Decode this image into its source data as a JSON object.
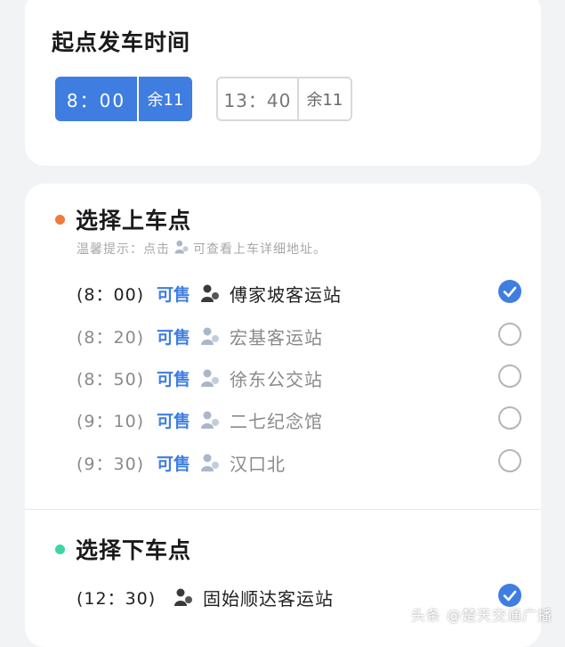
{
  "departure": {
    "title": "起点发车时间",
    "options": [
      {
        "time": "8：00",
        "remaining": "余11",
        "selected": true
      },
      {
        "time": "13：40",
        "remaining": "余11",
        "selected": false
      }
    ]
  },
  "boarding": {
    "title": "选择上车点",
    "dot_color": "#f07a3a",
    "tip_prefix": "温馨提示：点击",
    "tip_suffix": "可查看上车详细地址。",
    "stops": [
      {
        "time": "(8：00)",
        "sale": "可售",
        "name": "傅家坡客运站",
        "selected": true
      },
      {
        "time": "(8：20)",
        "sale": "可售",
        "name": "宏基客运站",
        "selected": false
      },
      {
        "time": "(8：50)",
        "sale": "可售",
        "name": "徐东公交站",
        "selected": false
      },
      {
        "time": "(9：10)",
        "sale": "可售",
        "name": "二七纪念馆",
        "selected": false
      },
      {
        "time": "(9：30)",
        "sale": "可售",
        "name": "汉口北",
        "selected": false
      }
    ]
  },
  "alighting": {
    "title": "选择下车点",
    "dot_color": "#3dd6a0",
    "stops": [
      {
        "time": "(12：30)",
        "name": "固始顺达客运站",
        "selected": true
      }
    ]
  },
  "watermark": "头条 @楚天交通广播",
  "colors": {
    "accent": "#3f7ee0",
    "pin_active": "#3a3a3a",
    "pin_muted": "#a9b6cc"
  },
  "icons": {
    "pin": "location-person-icon",
    "check": "check-circle-icon",
    "radio": "radio-circle-icon"
  }
}
